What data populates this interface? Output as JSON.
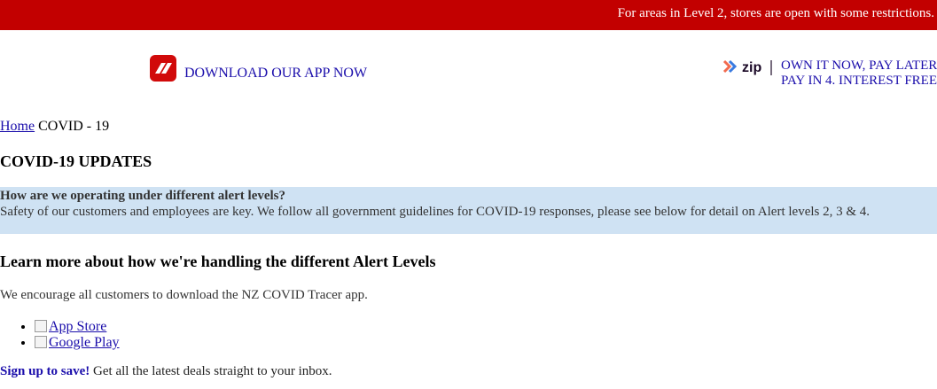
{
  "banner": {
    "text": "For areas in Level 2, stores are open with some restrictions."
  },
  "app_promo": {
    "logo_icon": "app-logo-icon",
    "link_text": "DOWNLOAD OUR APP NOW",
    "brand_color": "#d10a0a"
  },
  "zip_promo": {
    "logo_text": "zip",
    "line1": "OWN IT NOW, PAY LATER",
    "line2": "PAY IN 4. INTEREST FREE"
  },
  "breadcrumb": {
    "home": "Home",
    "current": "COVID - 19"
  },
  "page_title": "COVID-19 UPDATES",
  "info_box": {
    "question": "How are we operating under different alert levels?",
    "body": "Safety of our customers and employees are key. We follow all government guidelines for COVID-19 responses, please see below for detail on Alert levels 2, 3 & 4."
  },
  "section": {
    "heading": "Learn more about how we're handling the different Alert Levels",
    "encourage": "We encourage all customers to download the NZ COVID Tracer app."
  },
  "stores": [
    {
      "alt": "App Store"
    },
    {
      "alt": "Google Play"
    }
  ],
  "newsletter": {
    "link": "Sign up to save!",
    "text": " Get all the latest deals straight to your inbox."
  },
  "colors": {
    "banner_bg": "#c20000",
    "info_bg": "#cfe2f3",
    "link": "#1a0dab"
  }
}
